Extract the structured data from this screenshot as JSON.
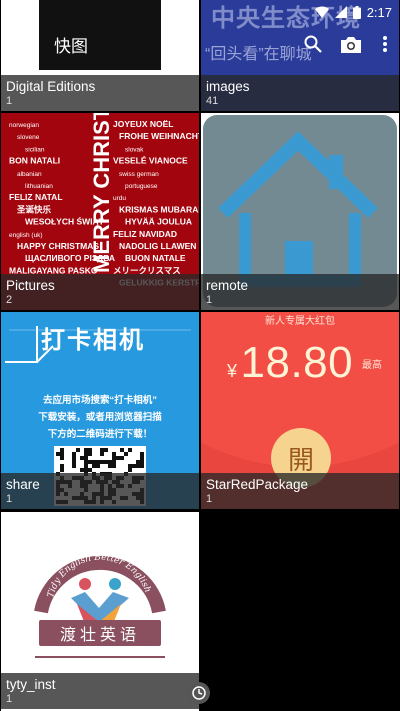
{
  "status_bar": {
    "time": "2:17"
  },
  "app_bar": {
    "title": "快图"
  },
  "albums": [
    {
      "name": "Digital Editions",
      "count": "1"
    },
    {
      "name": "images",
      "count": "41"
    },
    {
      "name": "Pictures",
      "count": "2"
    },
    {
      "name": "remote",
      "count": "1"
    },
    {
      "name": "share",
      "count": "1"
    },
    {
      "name": "StarRedPackage",
      "count": "1"
    },
    {
      "name": "tyty_inst",
      "count": "1"
    }
  ],
  "thumbs": {
    "images": {
      "big": "中央生态环境",
      "small": "“回头看”在聊城"
    },
    "pictures": {
      "vertical": "MERRY CHRISTMAS",
      "words": [
        "norwegian",
        "slovene",
        "sicilian",
        "BON NATALI",
        "albanian",
        "lithuanian",
        "FELIZ NATAL",
        "圣诞快乐",
        "WESOŁYCH ŚWIĄT",
        "english (uk)",
        "HAPPY CHRISTMAS",
        "ЩАСЛИВОГО РІЗДВА",
        "MALIGAYANG PASKO",
        "french",
        "JOYEUX NOËL",
        "FROHE WEIHNACHT",
        "slovak",
        "VESELÉ VIANOCE",
        "swiss german",
        "portuguese",
        "urdu",
        "KRISMAS MUBARAK",
        "HYVÄÄ JOULUA",
        "FELIZ NAVIDAD",
        "NADOLIG LLAWEN",
        "BUON NATALE",
        "メリークリスマス",
        "GELUKKIG KERSTFEEST"
      ]
    },
    "share": {
      "headline": "打卡相机",
      "line1": "去应用市场搜索“打卡相机”",
      "line2": "下载安装，或者用浏览器扫描",
      "line3": "下方的二维码进行下载！"
    },
    "star_red_package": {
      "banner": "新人专属大红包",
      "currency": "¥",
      "amount": "18.80",
      "tag": "最高",
      "button": "開"
    },
    "tyty_inst": {
      "arc_text": "Tidy English Better English",
      "band_text": "渡壮英语"
    }
  }
}
